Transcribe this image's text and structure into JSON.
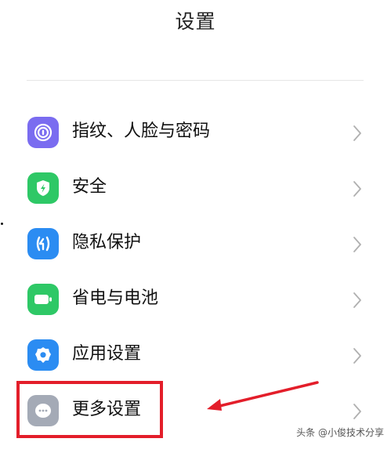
{
  "header": {
    "title": "设置"
  },
  "menu": {
    "items": [
      {
        "label": "指纹、人脸与密码",
        "icon": "fingerprint-icon",
        "color": "#7a6cf0"
      },
      {
        "label": "安全",
        "icon": "shield-bolt-icon",
        "color": "#2ec866"
      },
      {
        "label": "隐私保护",
        "icon": "privacy-lock-icon",
        "color": "#2b8cf2"
      },
      {
        "label": "省电与电池",
        "icon": "battery-icon",
        "color": "#2ec866"
      },
      {
        "label": "应用设置",
        "icon": "gear-icon",
        "color": "#2b8cf2"
      },
      {
        "label": "更多设置",
        "icon": "more-dots-icon",
        "color": "#a4aab6"
      }
    ]
  },
  "annotation": {
    "highlight_color": "#e31e2a"
  },
  "watermark": {
    "text": "头条 @小俊技术分享"
  }
}
